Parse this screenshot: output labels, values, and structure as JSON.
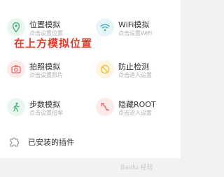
{
  "overlay_caption": "在上方模拟位置",
  "tiles": [
    {
      "title": "位置模拟",
      "subtitle": "点击设置位置",
      "icon": "location-pin-icon",
      "color": "#4caf7a"
    },
    {
      "title": "WiFi模拟",
      "subtitle": "点击设置WiFi",
      "icon": "wifi-icon",
      "color": "#3fb0b8"
    },
    {
      "title": "拍照模拟",
      "subtitle": "点击设置照片",
      "icon": "camera-icon",
      "color": "#ef6a6a"
    },
    {
      "title": "防止检测",
      "subtitle": "点击进入设置",
      "icon": "block-icon",
      "color": "#f0c24a"
    },
    {
      "title": "步数模拟",
      "subtitle": "点击设置倍率",
      "icon": "walking-icon",
      "color": "#4caf7a"
    },
    {
      "title": "隐藏ROOT",
      "subtitle": "点击进入设置",
      "icon": "hide-root-icon",
      "color": "#e76f6f"
    }
  ],
  "plugins": {
    "label": "已安装的插件",
    "icon": "puzzle-icon"
  },
  "watermark": "Baidu 经验"
}
